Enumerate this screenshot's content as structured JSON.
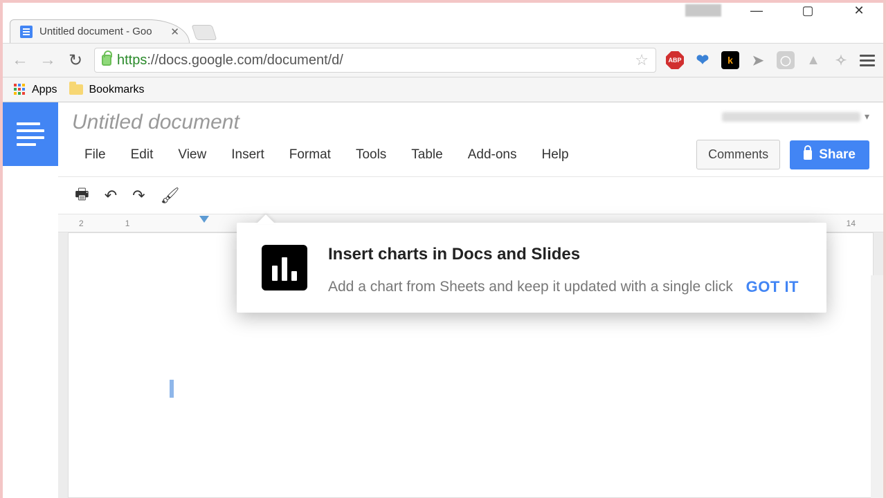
{
  "window": {
    "tab_title": "Untitled document - Goo",
    "url_scheme": "https",
    "url_host": "://docs.google.com",
    "url_path": "/document/d/"
  },
  "bookmarks_bar": {
    "apps_label": "Apps",
    "bookmarks_label": "Bookmarks"
  },
  "docs": {
    "title": "Untitled document",
    "menus": {
      "file": "File",
      "edit": "Edit",
      "view": "View",
      "insert": "Insert",
      "format": "Format",
      "tools": "Tools",
      "table": "Table",
      "addons": "Add-ons",
      "help": "Help"
    },
    "comments_label": "Comments",
    "share_label": "Share"
  },
  "ruler": {
    "m2": "2",
    "m1": "1",
    "m14": "14"
  },
  "popover": {
    "title": "Insert charts in Docs and Slides",
    "description": "Add a chart from Sheets and keep it updated with a single click",
    "action": "GOT IT"
  },
  "icons": {
    "abp": "ABP",
    "k": "k"
  }
}
